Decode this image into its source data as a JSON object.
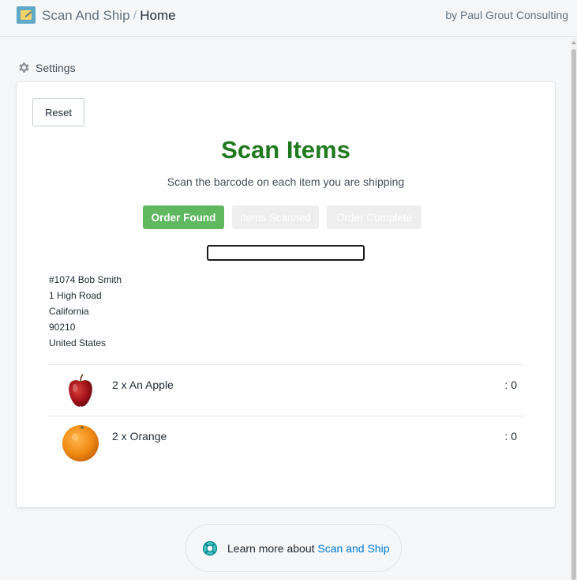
{
  "header": {
    "app_name": "Scan And Ship",
    "separator": "/",
    "page": "Home",
    "byline": "by Paul Grout Consulting",
    "app_icon": "notepad-pen-icon"
  },
  "settings": {
    "label": "Settings",
    "icon": "gear-icon"
  },
  "card": {
    "reset_label": "Reset",
    "title": "Scan Items",
    "subtitle": "Scan the barcode on each item you are shipping",
    "title_color": "#1f7a1f",
    "steps": [
      {
        "label": "Order Found",
        "state": "active"
      },
      {
        "label": "Items Scanned",
        "state": "inactive"
      },
      {
        "label": "Order Complete",
        "state": "inactive"
      }
    ],
    "barcode_input": {
      "value": "",
      "placeholder": ""
    },
    "address": {
      "line1": "#1074 Bob Smith",
      "line2": "1 High Road",
      "line3": "California",
      "line4": "90210",
      "line5": "United States"
    },
    "items": [
      {
        "label": "2 x An Apple",
        "count": ": 0",
        "image": "apple"
      },
      {
        "label": "2 x Orange",
        "count": ": 0",
        "image": "orange"
      }
    ]
  },
  "footer": {
    "prefix": "Learn more about",
    "link": "Scan and Ship",
    "icon": "lifebuoy-icon"
  },
  "colors": {
    "accent_green": "#5fb85f",
    "link_blue": "#007ace"
  }
}
